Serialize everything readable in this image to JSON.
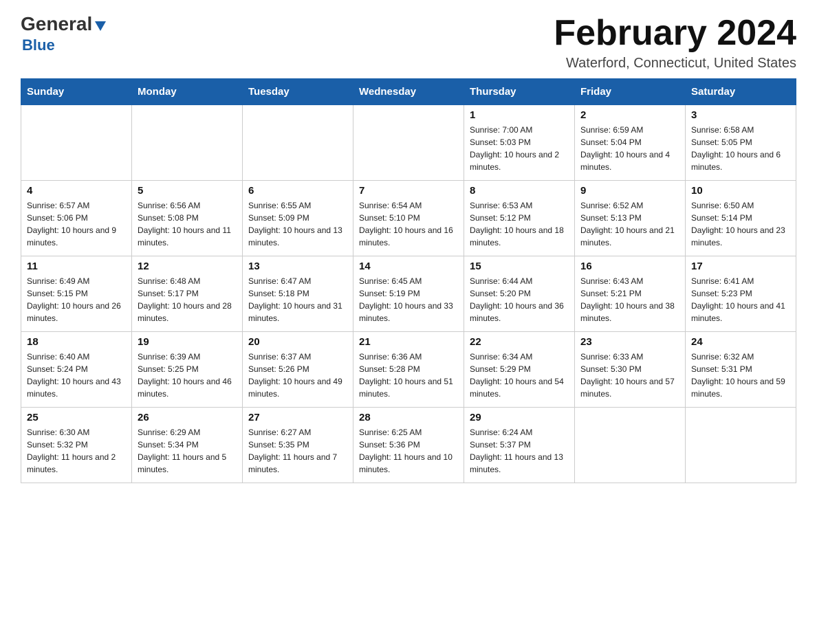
{
  "header": {
    "logo_general": "General",
    "logo_blue": "Blue",
    "month_title": "February 2024",
    "location": "Waterford, Connecticut, United States"
  },
  "days_of_week": [
    "Sunday",
    "Monday",
    "Tuesday",
    "Wednesday",
    "Thursday",
    "Friday",
    "Saturday"
  ],
  "weeks": [
    [
      {
        "day": "",
        "info": ""
      },
      {
        "day": "",
        "info": ""
      },
      {
        "day": "",
        "info": ""
      },
      {
        "day": "",
        "info": ""
      },
      {
        "day": "1",
        "info": "Sunrise: 7:00 AM\nSunset: 5:03 PM\nDaylight: 10 hours and 2 minutes."
      },
      {
        "day": "2",
        "info": "Sunrise: 6:59 AM\nSunset: 5:04 PM\nDaylight: 10 hours and 4 minutes."
      },
      {
        "day": "3",
        "info": "Sunrise: 6:58 AM\nSunset: 5:05 PM\nDaylight: 10 hours and 6 minutes."
      }
    ],
    [
      {
        "day": "4",
        "info": "Sunrise: 6:57 AM\nSunset: 5:06 PM\nDaylight: 10 hours and 9 minutes."
      },
      {
        "day": "5",
        "info": "Sunrise: 6:56 AM\nSunset: 5:08 PM\nDaylight: 10 hours and 11 minutes."
      },
      {
        "day": "6",
        "info": "Sunrise: 6:55 AM\nSunset: 5:09 PM\nDaylight: 10 hours and 13 minutes."
      },
      {
        "day": "7",
        "info": "Sunrise: 6:54 AM\nSunset: 5:10 PM\nDaylight: 10 hours and 16 minutes."
      },
      {
        "day": "8",
        "info": "Sunrise: 6:53 AM\nSunset: 5:12 PM\nDaylight: 10 hours and 18 minutes."
      },
      {
        "day": "9",
        "info": "Sunrise: 6:52 AM\nSunset: 5:13 PM\nDaylight: 10 hours and 21 minutes."
      },
      {
        "day": "10",
        "info": "Sunrise: 6:50 AM\nSunset: 5:14 PM\nDaylight: 10 hours and 23 minutes."
      }
    ],
    [
      {
        "day": "11",
        "info": "Sunrise: 6:49 AM\nSunset: 5:15 PM\nDaylight: 10 hours and 26 minutes."
      },
      {
        "day": "12",
        "info": "Sunrise: 6:48 AM\nSunset: 5:17 PM\nDaylight: 10 hours and 28 minutes."
      },
      {
        "day": "13",
        "info": "Sunrise: 6:47 AM\nSunset: 5:18 PM\nDaylight: 10 hours and 31 minutes."
      },
      {
        "day": "14",
        "info": "Sunrise: 6:45 AM\nSunset: 5:19 PM\nDaylight: 10 hours and 33 minutes."
      },
      {
        "day": "15",
        "info": "Sunrise: 6:44 AM\nSunset: 5:20 PM\nDaylight: 10 hours and 36 minutes."
      },
      {
        "day": "16",
        "info": "Sunrise: 6:43 AM\nSunset: 5:21 PM\nDaylight: 10 hours and 38 minutes."
      },
      {
        "day": "17",
        "info": "Sunrise: 6:41 AM\nSunset: 5:23 PM\nDaylight: 10 hours and 41 minutes."
      }
    ],
    [
      {
        "day": "18",
        "info": "Sunrise: 6:40 AM\nSunset: 5:24 PM\nDaylight: 10 hours and 43 minutes."
      },
      {
        "day": "19",
        "info": "Sunrise: 6:39 AM\nSunset: 5:25 PM\nDaylight: 10 hours and 46 minutes."
      },
      {
        "day": "20",
        "info": "Sunrise: 6:37 AM\nSunset: 5:26 PM\nDaylight: 10 hours and 49 minutes."
      },
      {
        "day": "21",
        "info": "Sunrise: 6:36 AM\nSunset: 5:28 PM\nDaylight: 10 hours and 51 minutes."
      },
      {
        "day": "22",
        "info": "Sunrise: 6:34 AM\nSunset: 5:29 PM\nDaylight: 10 hours and 54 minutes."
      },
      {
        "day": "23",
        "info": "Sunrise: 6:33 AM\nSunset: 5:30 PM\nDaylight: 10 hours and 57 minutes."
      },
      {
        "day": "24",
        "info": "Sunrise: 6:32 AM\nSunset: 5:31 PM\nDaylight: 10 hours and 59 minutes."
      }
    ],
    [
      {
        "day": "25",
        "info": "Sunrise: 6:30 AM\nSunset: 5:32 PM\nDaylight: 11 hours and 2 minutes."
      },
      {
        "day": "26",
        "info": "Sunrise: 6:29 AM\nSunset: 5:34 PM\nDaylight: 11 hours and 5 minutes."
      },
      {
        "day": "27",
        "info": "Sunrise: 6:27 AM\nSunset: 5:35 PM\nDaylight: 11 hours and 7 minutes."
      },
      {
        "day": "28",
        "info": "Sunrise: 6:25 AM\nSunset: 5:36 PM\nDaylight: 11 hours and 10 minutes."
      },
      {
        "day": "29",
        "info": "Sunrise: 6:24 AM\nSunset: 5:37 PM\nDaylight: 11 hours and 13 minutes."
      },
      {
        "day": "",
        "info": ""
      },
      {
        "day": "",
        "info": ""
      }
    ]
  ]
}
